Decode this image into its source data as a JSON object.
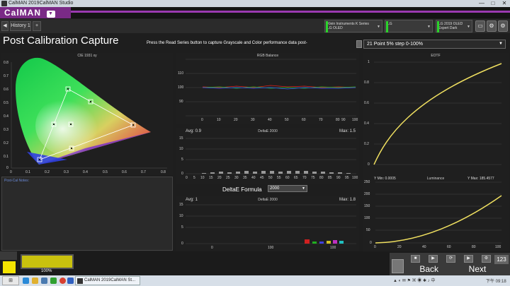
{
  "window": {
    "title": "CalMAN 2019CalMAN Studio",
    "min": "—",
    "max": "□",
    "close": "✕"
  },
  "app": {
    "logo": "CalMAN",
    "logo_arrow": "▼"
  },
  "tabs": {
    "history": "History 1",
    "add": "+",
    "back": "◀"
  },
  "devices": [
    {
      "line1": "Klein Instruments K Series",
      "line2": "LG OLED"
    },
    {
      "line1": "LG",
      "line2": ""
    },
    {
      "line1": "LG 2019 OLED",
      "line2": "Expert Dark"
    }
  ],
  "page": {
    "title": "Post Calibration Capture",
    "instruction": "Press the Read Series button to capture Grayscale and Color performance data post-",
    "series_select": "21 Point 5% step 0-100%"
  },
  "cie": {
    "title": "CIE 1931 xy",
    "y_ticks": [
      "0.8",
      "0.7",
      "0.6",
      "0.5",
      "0.4",
      "0.3",
      "0.2",
      "0.1",
      "0"
    ],
    "x_ticks": [
      "0",
      "0.1",
      "0.2",
      "0.3",
      "0.4",
      "0.5",
      "0.6",
      "0.7",
      "0.8"
    ]
  },
  "notes": {
    "label": "Post-Cal Notes:"
  },
  "rgb": {
    "title": "RGB Balance",
    "y_ticks": [
      "110",
      "100",
      "90"
    ],
    "x_ticks": [
      "0",
      "10",
      "20",
      "30",
      "40",
      "50",
      "60",
      "70",
      "80",
      "90",
      "100"
    ]
  },
  "de_gray": {
    "title": "DeltaE 2000",
    "avg": "Avg: 0.9",
    "max": "Max: 1.5",
    "y_ticks": [
      "15",
      "10",
      "5",
      "0"
    ],
    "x_ticks": [
      "0",
      "5",
      "10",
      "15",
      "20",
      "25",
      "30",
      "35",
      "40",
      "45",
      "50",
      "55",
      "60",
      "65",
      "70",
      "75",
      "80",
      "85",
      "90",
      "95",
      "100"
    ]
  },
  "formula": {
    "label": "DeltaE Formula",
    "value": "2000"
  },
  "de_color": {
    "title": "DeltaE 2000",
    "avg": "Avg: 1",
    "max": "Max: 1.8",
    "y_ticks": [
      "15",
      "10",
      "5",
      "0"
    ],
    "x_ticks": [
      "0",
      "100",
      "100"
    ]
  },
  "eotf": {
    "title": "EOTF",
    "y_ticks": [
      "1",
      "0.8",
      "0.6",
      "0.4",
      "0.2",
      "0"
    ],
    "x_ticks": [
      "0",
      "20",
      "40",
      "60",
      "80",
      "100"
    ]
  },
  "luminance": {
    "title": "Luminance",
    "ymin": "Y Min: 0.0005",
    "ymax": "Y Max: 185.4577",
    "y_ticks": [
      "250",
      "200",
      "150",
      "100",
      "50",
      "0"
    ],
    "x_ticks": [
      "0",
      "20",
      "40",
      "60",
      "80",
      "100"
    ]
  },
  "bottom": {
    "percent": "100%",
    "back": "Back",
    "next": "Next",
    "counter": "123"
  },
  "taskbar": {
    "start": "⊞",
    "task": "CalMAN 2019CalMAN St...",
    "clock": "下午 09:18"
  },
  "colors": {
    "accent": "#9a3ab0",
    "swatch": "#c9c20e",
    "curve": "#f0e060"
  }
}
